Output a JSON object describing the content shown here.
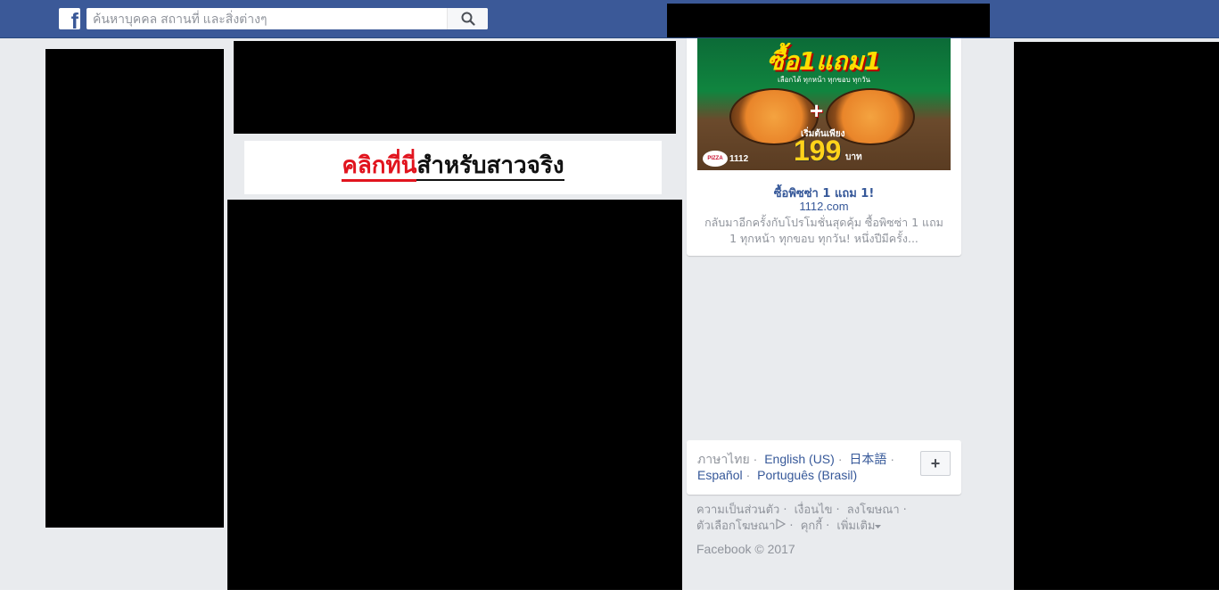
{
  "header": {
    "logo_letter": "f",
    "search_placeholder": "ค้นหาบุคคล สถานที่ และสิ่งต่างๆ",
    "brand_color": "#3b5998"
  },
  "banner": {
    "red_text": "คลิกที่นี่",
    "black_text": "สำหรับสาวจริง"
  },
  "ad": {
    "image_headline": "ซื้อ1แถม1",
    "image_sub": "เลือกได้ ทุกหน้า ทุกขอบ ทุกวัน",
    "image_price_prefix": "เริ่มต้นเพียง",
    "image_price": "199",
    "image_price_unit": "บาท",
    "image_brand": "PIZZA",
    "image_brand_number": "1112",
    "title": "ซื้อพิซซ่า 1 แถม 1!",
    "domain": "1112.com",
    "description": "กลับมาอีกครั้งกับโปรโมชั่นสุดคุ้ม ซื้อพิซซ่า 1 แถม 1 ทุกหน้า ทุกขอบ ทุกวัน! หนึ่งปีมีครั้ง..."
  },
  "languages": {
    "current": "ภาษาไทย",
    "options": [
      "English (US)",
      "日本語",
      "Español",
      "Português (Brasil)"
    ],
    "more_label": "+"
  },
  "footer": {
    "links": [
      "ความเป็นส่วนตัว",
      "เงื่อนไข",
      "ลงโฆษณา",
      "ตัวเลือกโฆษณา",
      "คุกกี้",
      "เพิ่มเติม"
    ],
    "copyright": "Facebook © 2017"
  }
}
